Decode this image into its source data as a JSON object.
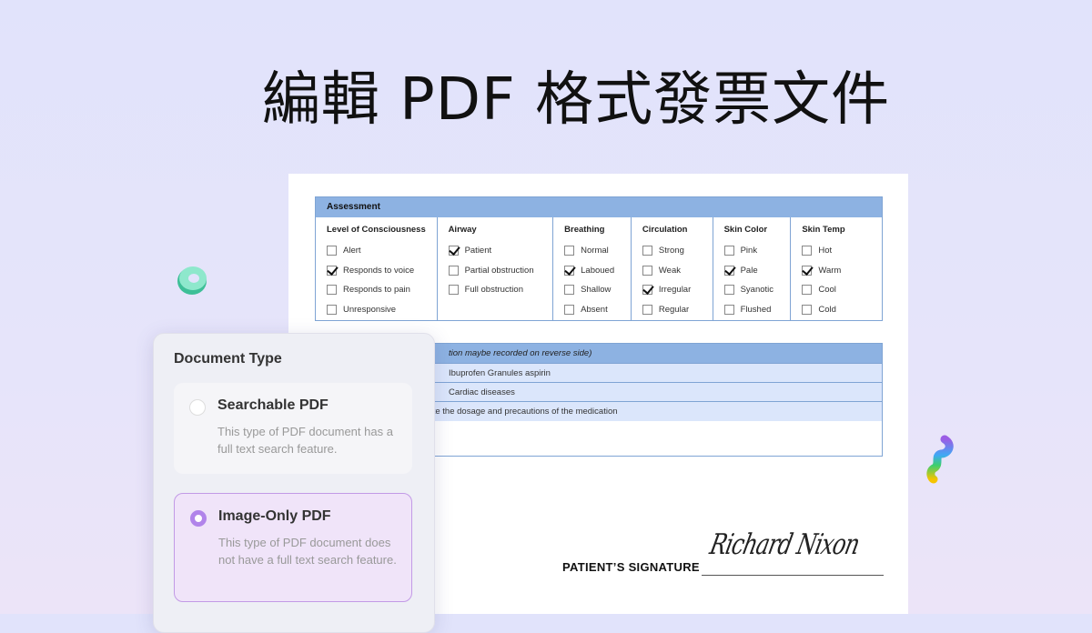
{
  "title": "編輯 PDF 格式發票文件",
  "assessment": {
    "header": "Assessment",
    "columns": [
      {
        "label": "Level of Consciousness",
        "options": [
          {
            "label": "Alert",
            "checked": false
          },
          {
            "label": "Responds to voice",
            "checked": true
          },
          {
            "label": "Responds to pain",
            "checked": false
          },
          {
            "label": "Unresponsive",
            "checked": false
          }
        ]
      },
      {
        "label": "Airway",
        "options": [
          {
            "label": "Patient",
            "checked": true
          },
          {
            "label": "Partial obstruction",
            "checked": false
          },
          {
            "label": "Full obstruction",
            "checked": false
          }
        ]
      },
      {
        "label": "Breathing",
        "options": [
          {
            "label": "Normal",
            "checked": false
          },
          {
            "label": "Laboued",
            "checked": true
          },
          {
            "label": "Shallow",
            "checked": false
          },
          {
            "label": "Absent",
            "checked": false
          }
        ]
      },
      {
        "label": "Circulation",
        "options": [
          {
            "label": "Strong",
            "checked": false
          },
          {
            "label": "Weak",
            "checked": false
          },
          {
            "label": "Irregular",
            "checked": true
          },
          {
            "label": "Regular",
            "checked": false
          }
        ]
      },
      {
        "label": "Skin Color",
        "options": [
          {
            "label": "Pink",
            "checked": false
          },
          {
            "label": "Pale",
            "checked": true
          },
          {
            "label": "Syanotic",
            "checked": false
          },
          {
            "label": "Flushed",
            "checked": false
          }
        ]
      },
      {
        "label": "Skin Temp",
        "options": [
          {
            "label": "Hot",
            "checked": false
          },
          {
            "label": "Warm",
            "checked": true
          },
          {
            "label": "Cool",
            "checked": false
          },
          {
            "label": "Cold",
            "checked": false
          }
        ]
      }
    ]
  },
  "medication": {
    "header": "tion maybe recorded on reverse side)",
    "rows": [
      "Ibuprofen Granules  aspirin",
      "Cardiac diseases"
    ],
    "note": "se ask the doctor to help note the dosage and precautions of the medication"
  },
  "signature": {
    "label": "PATIENT’S SIGNATURE",
    "signed_name": "Richard Nixon"
  },
  "panel": {
    "title": "Document Type",
    "options": [
      {
        "label": "Searchable PDF",
        "description": "This type of PDF document has a full text search feature.",
        "selected": false
      },
      {
        "label": "Image-Only PDF",
        "description": "This type of PDF document does not have a full text search feature.",
        "selected": true
      }
    ]
  },
  "colors": {
    "accent": "#b184ea",
    "table_header": "#8db2e2",
    "table_row": "#dbe6fb"
  }
}
